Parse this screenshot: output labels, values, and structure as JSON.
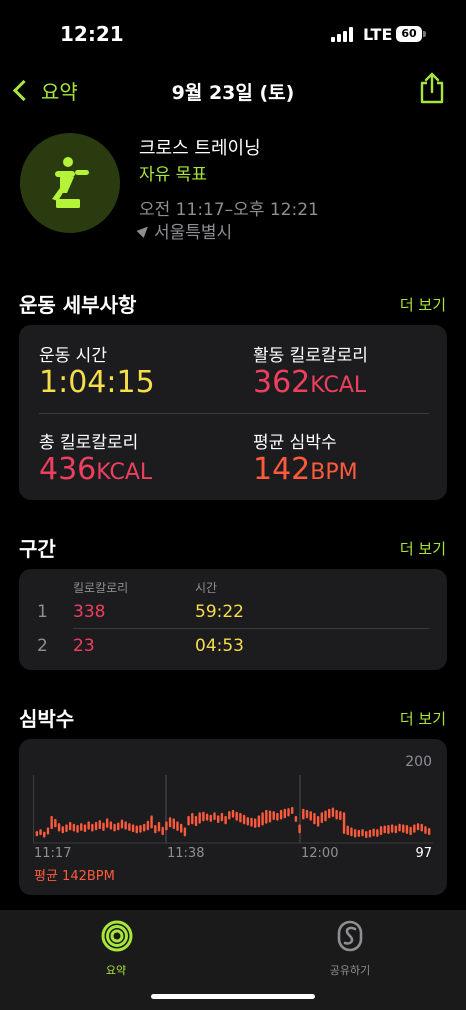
{
  "status": {
    "time": "12:21",
    "network": "LTE",
    "battery": "60"
  },
  "nav": {
    "back_label": "요약",
    "title": "9월 23일 (토)"
  },
  "workout": {
    "name": "크로스 트레이닝",
    "goal": "자유 목표",
    "time_range": "오전 11:17–오후 12:21",
    "location": "서울특별시"
  },
  "details": {
    "title": "운동 세부사항",
    "more": "더 보기",
    "duration_label": "운동 시간",
    "duration_value": "1:04:15",
    "active_cal_label": "활동 킬로칼로리",
    "active_cal_value": "362",
    "active_cal_unit": "KCAL",
    "total_cal_label": "총 킬로칼로리",
    "total_cal_value": "436",
    "total_cal_unit": "KCAL",
    "avg_hr_label": "평균 심박수",
    "avg_hr_value": "142",
    "avg_hr_unit": "BPM"
  },
  "segments": {
    "title": "구간",
    "more": "더 보기",
    "col_cal": "킬로칼로리",
    "col_time": "시간",
    "rows": [
      {
        "index": "1",
        "cal": "338",
        "time": "59:22"
      },
      {
        "index": "2",
        "cal": "23",
        "time": "04:53"
      }
    ]
  },
  "heart": {
    "title": "심박수",
    "more": "더 보기",
    "max_label": "200",
    "min_label": "97",
    "x_labels": [
      "11:17",
      "11:38",
      "12:00"
    ],
    "avg_text": "평균 142BPM"
  },
  "chart_data": {
    "type": "bar",
    "ylim": [
      97,
      200
    ],
    "x": [
      "11:17",
      "11:38",
      "12:00"
    ],
    "color": "#ff5a3c",
    "series": [
      {
        "values": [
          [
            110,
            115
          ],
          [
            112,
            118
          ],
          [
            108,
            114
          ],
          [
            113,
            121
          ],
          [
            122,
            140
          ],
          [
            125,
            135
          ],
          [
            118,
            128
          ],
          [
            115,
            123
          ],
          [
            117,
            126
          ],
          [
            120,
            130
          ],
          [
            118,
            127
          ],
          [
            116,
            125
          ],
          [
            119,
            128
          ],
          [
            117,
            126
          ],
          [
            121,
            131
          ],
          [
            118,
            127
          ],
          [
            120,
            130
          ],
          [
            122,
            133
          ],
          [
            119,
            129
          ],
          [
            124,
            136
          ],
          [
            121,
            131
          ],
          [
            118,
            127
          ],
          [
            120,
            129
          ],
          [
            123,
            134
          ],
          [
            121,
            131
          ],
          [
            119,
            128
          ],
          [
            117,
            126
          ],
          [
            115,
            124
          ],
          [
            116,
            125
          ],
          [
            118,
            127
          ],
          [
            120,
            132
          ],
          [
            123,
            141
          ],
          [
            115,
            125
          ],
          [
            118,
            130
          ],
          [
            112,
            122
          ],
          [
            120,
            131
          ],
          [
            125,
            138
          ],
          [
            122,
            136
          ],
          [
            119,
            131
          ],
          [
            116,
            127
          ],
          [
            110,
            121
          ],
          [
            128,
            140
          ],
          [
            130,
            145
          ],
          [
            127,
            140
          ],
          [
            131,
            146
          ],
          [
            135,
            147
          ],
          [
            136,
            144
          ],
          [
            134,
            142
          ],
          [
            137,
            146
          ],
          [
            132,
            141
          ],
          [
            135,
            145
          ],
          [
            130,
            140
          ],
          [
            138,
            148
          ],
          [
            141,
            150
          ],
          [
            136,
            147
          ],
          [
            133,
            145
          ],
          [
            130,
            142
          ],
          [
            128,
            138
          ],
          [
            126,
            137
          ],
          [
            124,
            136
          ],
          [
            125,
            141
          ],
          [
            128,
            146
          ],
          [
            131,
            150
          ],
          [
            133,
            149
          ],
          [
            137,
            148
          ],
          [
            136,
            145
          ],
          [
            138,
            150
          ],
          [
            140,
            152
          ],
          [
            143,
            153
          ],
          [
            147,
            155
          ],
          [
            134,
            140
          ],
          [
            115,
            126
          ],
          [
            138,
            152
          ],
          [
            140,
            150
          ],
          [
            136,
            148
          ],
          [
            130,
            145
          ],
          [
            126,
            140
          ],
          [
            132,
            146
          ],
          [
            135,
            149
          ],
          [
            140,
            152
          ],
          [
            142,
            154
          ],
          [
            138,
            150
          ],
          [
            137,
            148
          ],
          [
            114,
            146
          ],
          [
            112,
            124
          ],
          [
            110,
            121
          ],
          [
            108,
            118
          ],
          [
            109,
            117
          ],
          [
            110,
            118
          ],
          [
            107,
            115
          ],
          [
            108,
            117
          ],
          [
            110,
            119
          ],
          [
            109,
            118
          ],
          [
            112,
            123
          ],
          [
            115,
            124
          ],
          [
            114,
            125
          ],
          [
            116,
            126
          ],
          [
            115,
            124
          ],
          [
            118,
            127
          ],
          [
            116,
            126
          ],
          [
            114,
            125
          ],
          [
            112,
            122
          ],
          [
            116,
            126
          ],
          [
            120,
            128
          ],
          [
            118,
            127
          ],
          [
            114,
            123
          ],
          [
            112,
            120
          ]
        ]
      }
    ]
  },
  "tabs": [
    {
      "label": "요약",
      "active": true
    },
    {
      "label": "공유하기",
      "active": false
    }
  ],
  "colors": {
    "accent": "#a8e63a",
    "yellow": "#f6dd4b",
    "red": "#ee3f5f",
    "orange": "#ff5a3c"
  },
  "icons": [
    "back-chevron-icon",
    "share-icon",
    "cross-training-icon",
    "location-arrow-icon",
    "activity-rings-icon",
    "sharing-icon"
  ]
}
